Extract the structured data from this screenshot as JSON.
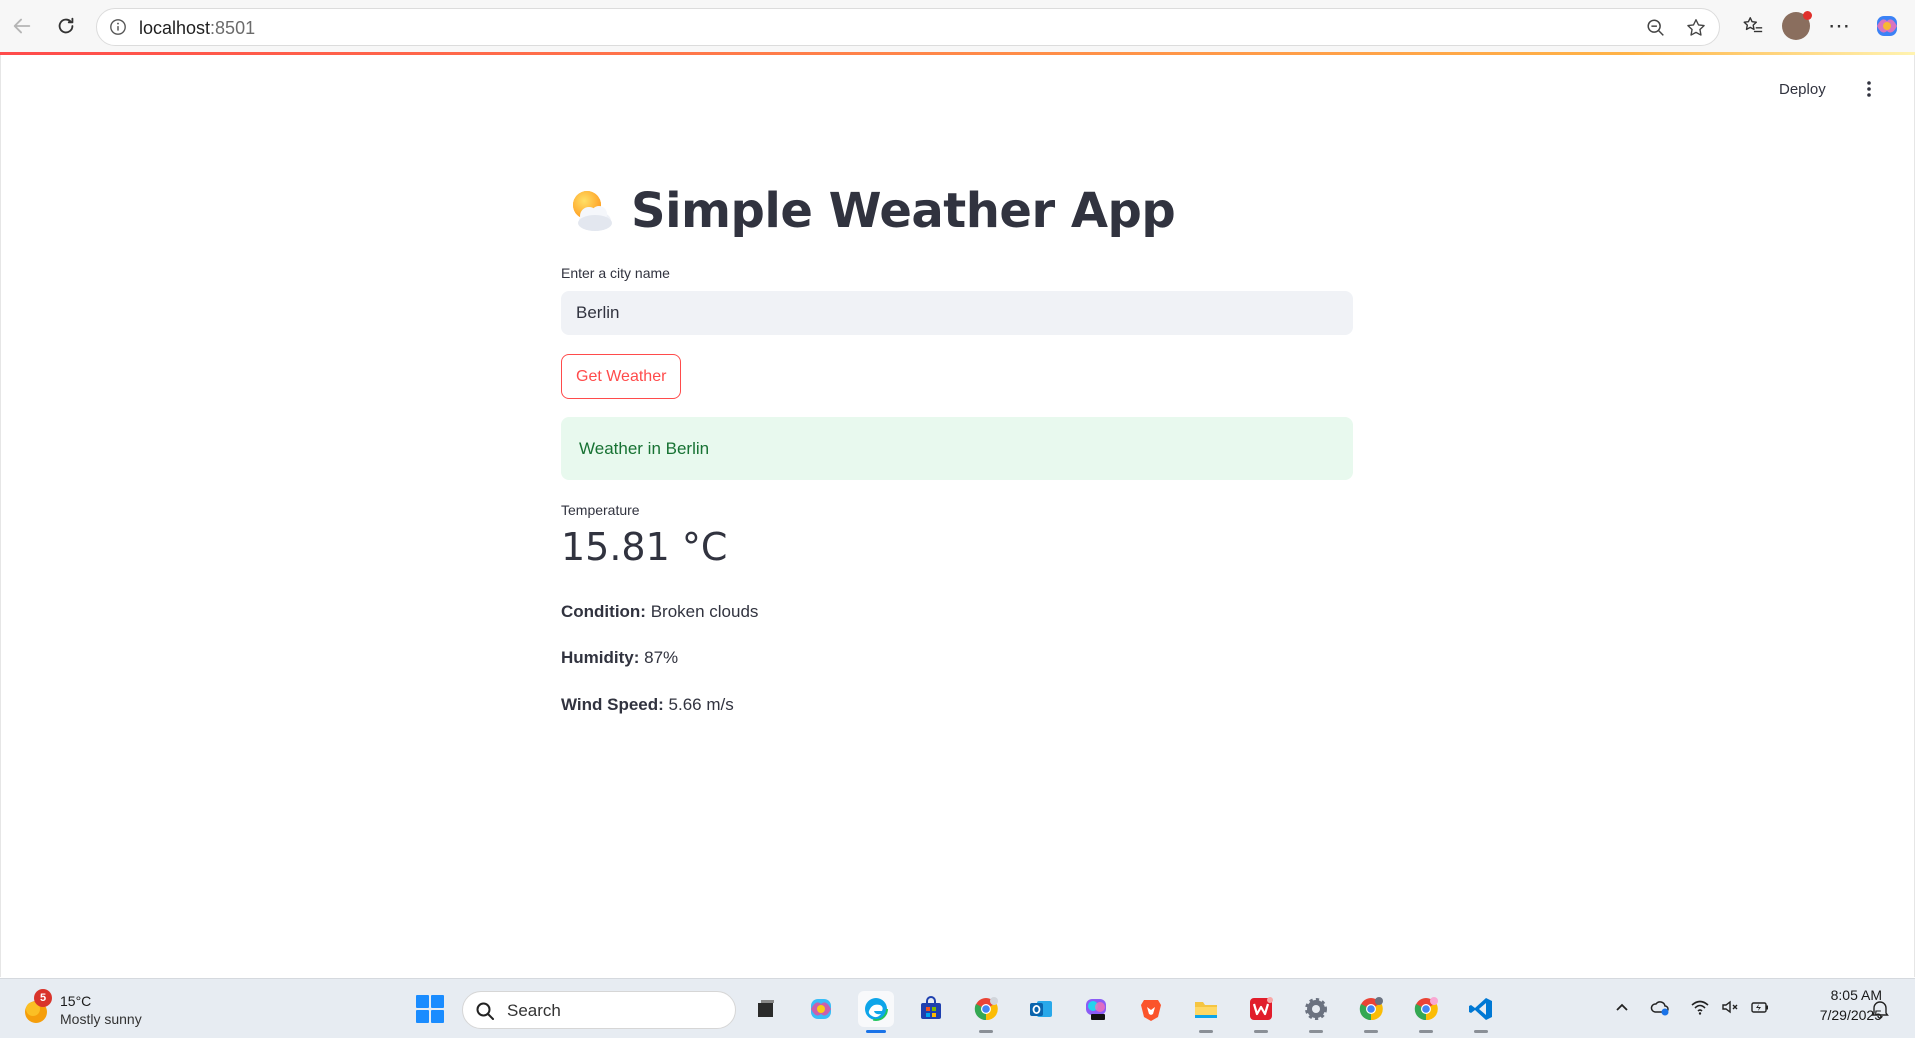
{
  "browser": {
    "url_host": "localhost",
    "url_port": ":8501"
  },
  "app": {
    "deploy_label": "Deploy",
    "title": "Simple Weather App",
    "input_label": "Enter a city name",
    "input_value": "Berlin",
    "button_label": "Get Weather",
    "success_message": "Weather in Berlin",
    "metric_label": "Temperature",
    "metric_value": "15.81 °C",
    "condition_label": "Condition:",
    "condition_value": " Broken clouds",
    "humidity_label": "Humidity:",
    "humidity_value": " 87%",
    "wind_label": "Wind Speed:",
    "wind_value": " 5.66 m/s"
  },
  "taskbar": {
    "weather_badge": "5",
    "weather_temp": "15°C",
    "weather_desc": "Mostly sunny",
    "search_label": "Search",
    "time": "8:05 AM",
    "date": "7/29/2025",
    "apps": [
      "task-view",
      "copilot",
      "edge",
      "microsoft-store",
      "chrome-profile-1",
      "outlook",
      "microsoft-365",
      "brave",
      "file-explorer",
      "wps-office",
      "settings",
      "chrome-profile-2",
      "chrome-profile-3",
      "vscode"
    ]
  },
  "colors": {
    "accent": "#ff4b4b",
    "success_bg": "#e8f9ee",
    "success_text": "#177233",
    "text": "#31333f"
  }
}
